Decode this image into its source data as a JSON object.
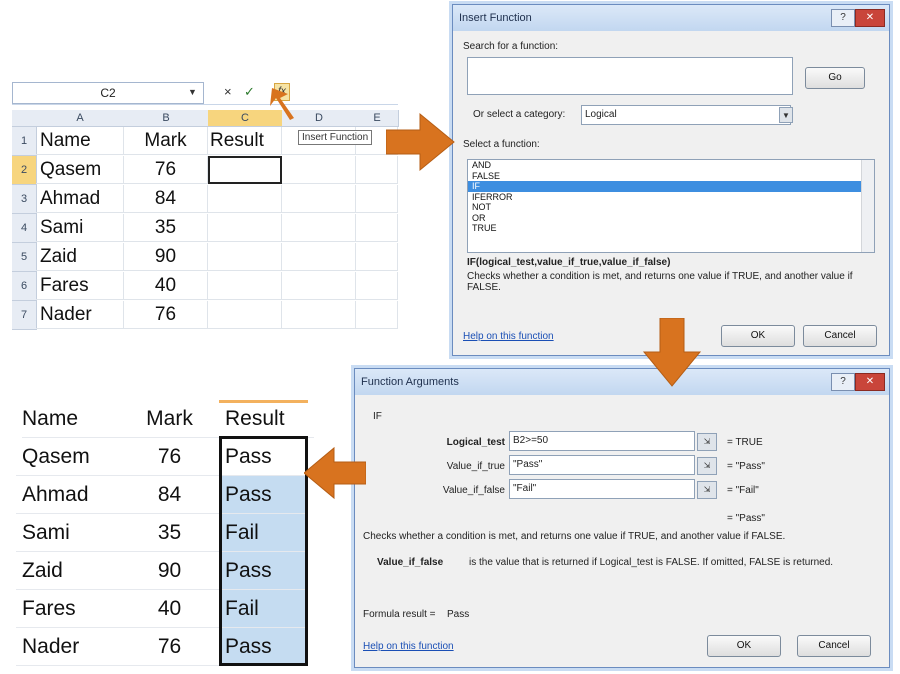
{
  "excel": {
    "name_box": "C2",
    "formula_icons": {
      "cancel": "×",
      "enter": "✓",
      "fx": "fx"
    },
    "columns": [
      "A",
      "B",
      "C",
      "D",
      "E"
    ],
    "rows": [
      {
        "num": "1",
        "name": "Name",
        "mark": "Mark",
        "result": "Result"
      },
      {
        "num": "2",
        "name": "Qasem",
        "mark": "76",
        "result": ""
      },
      {
        "num": "3",
        "name": "Ahmad",
        "mark": "84",
        "result": ""
      },
      {
        "num": "4",
        "name": "Sami",
        "mark": "35",
        "result": ""
      },
      {
        "num": "5",
        "name": "Zaid",
        "mark": "90",
        "result": ""
      },
      {
        "num": "6",
        "name": "Fares",
        "mark": "40",
        "result": ""
      },
      {
        "num": "7",
        "name": "Nader",
        "mark": "76",
        "result": ""
      }
    ],
    "tooltip": "Insert Function"
  },
  "insert_function": {
    "title": "Insert Function",
    "search_label": "Search for a function:",
    "go": "Go",
    "category_label": "Or select a category:",
    "category_value": "Logical",
    "select_label": "Select a function:",
    "functions": [
      "AND",
      "FALSE",
      "IF",
      "IFERROR",
      "NOT",
      "OR",
      "TRUE"
    ],
    "selected_function": "IF",
    "syntax": "IF(logical_test,value_if_true,value_if_false)",
    "description": "Checks whether a condition is met, and returns one value if TRUE, and another value if FALSE.",
    "help": "Help on this function",
    "ok": "OK",
    "cancel": "Cancel"
  },
  "function_arguments": {
    "title": "Function Arguments",
    "fn_name": "IF",
    "args": [
      {
        "label": "Logical_test",
        "value": "B2>=50",
        "result": "= TRUE"
      },
      {
        "label": "Value_if_true",
        "value": "\"Pass\"",
        "result": "= \"Pass\""
      },
      {
        "label": "Value_if_false",
        "value": "\"Fail\"",
        "result": "= \"Fail\""
      }
    ],
    "overall_result": "= \"Pass\"",
    "description": "Checks whether a condition is met, and returns one value if TRUE, and another value if FALSE.",
    "param_name": "Value_if_false",
    "param_desc": "is the value that is returned if Logical_test is FALSE. If omitted, FALSE is returned.",
    "formula_result": "Formula result =",
    "formula_value": "Pass",
    "help": "Help on this function",
    "ok": "OK",
    "cancel": "Cancel"
  },
  "result_table": {
    "headers": [
      "Name",
      "Mark",
      "Result"
    ],
    "rows": [
      [
        "Qasem",
        "76",
        "Pass"
      ],
      [
        "Ahmad",
        "84",
        "Pass"
      ],
      [
        "Sami",
        "35",
        "Fail"
      ],
      [
        "Zaid",
        "90",
        "Pass"
      ],
      [
        "Fares",
        "40",
        "Fail"
      ],
      [
        "Nader",
        "76",
        "Pass"
      ]
    ]
  },
  "colors": {
    "arrow": "#d8731f",
    "selection": "#c5dcf1",
    "header_highlight": "#f7d57e"
  }
}
